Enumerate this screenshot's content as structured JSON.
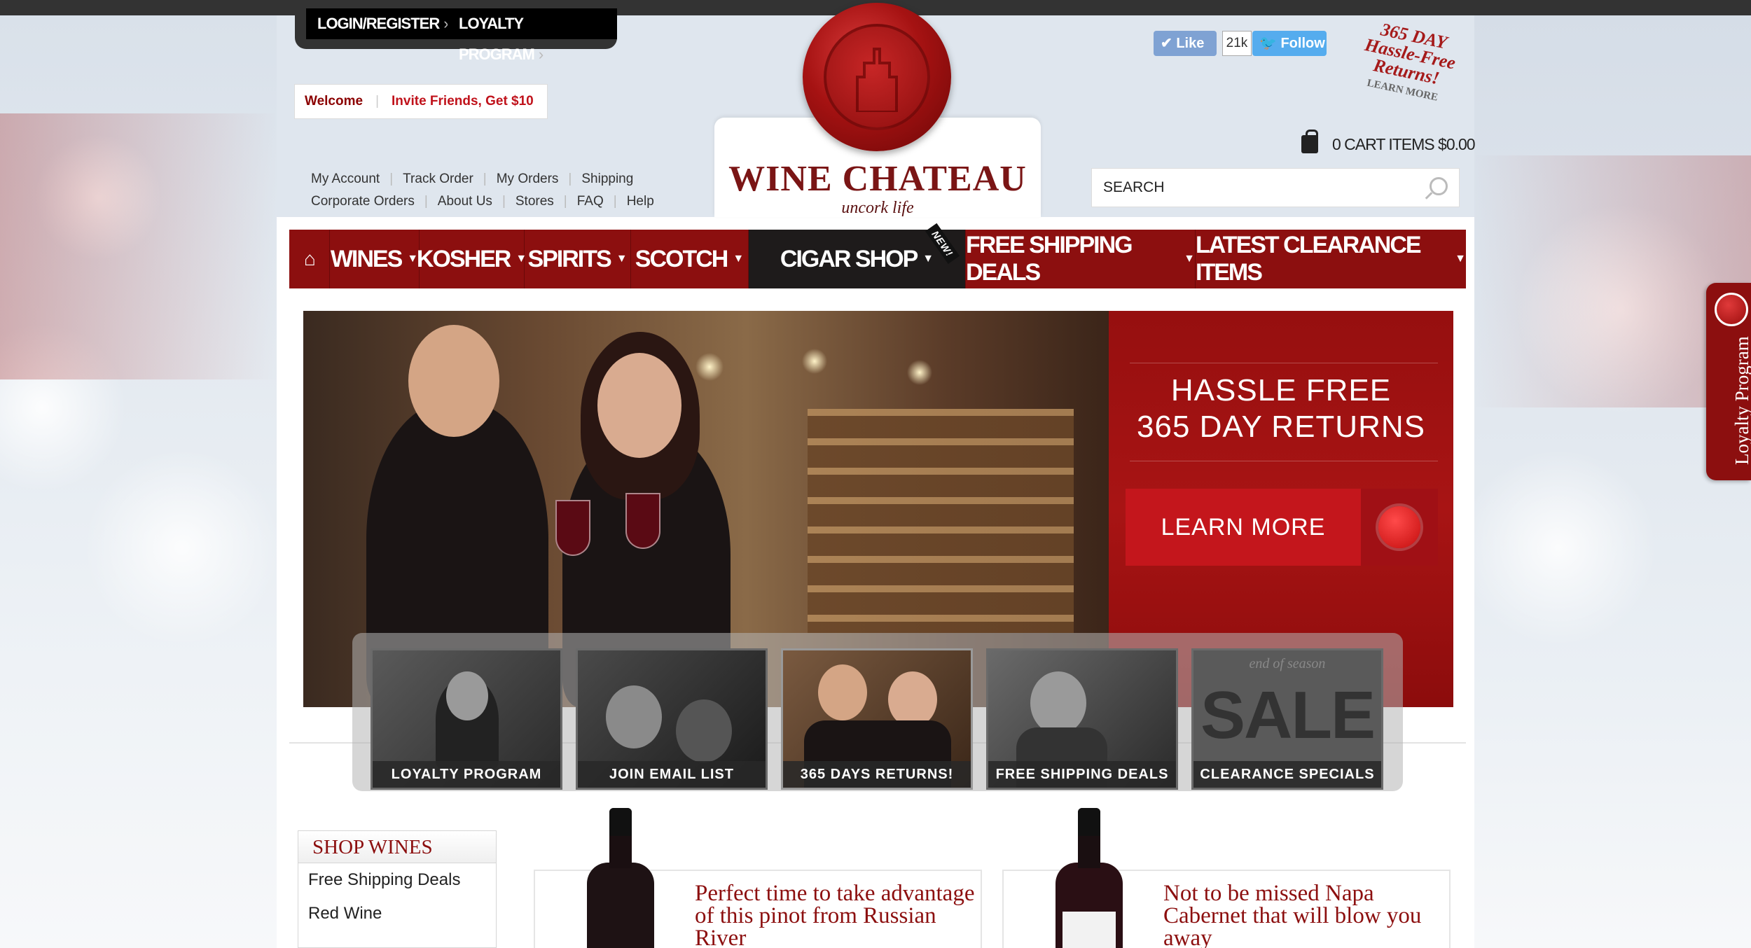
{
  "account": {
    "login_label": "LOGIN/REGISTER",
    "loyalty_label": "LOYALTY PROGRAM",
    "welcome": "Welcome",
    "invite": "Invite Friends, Get $10"
  },
  "links": {
    "row1": [
      "My Account",
      "Track Order",
      "My Orders",
      "Shipping"
    ],
    "row2": [
      "Corporate Orders",
      "About Us",
      "Stores",
      "FAQ",
      "Help"
    ]
  },
  "logo": {
    "title": "WINE CHATEAU",
    "tagline": "uncork life"
  },
  "social": {
    "like": "Like",
    "like_count": "21k",
    "follow": "Follow"
  },
  "returns_badge": {
    "line1": "365 DAY",
    "line2": "Hassle-Free",
    "line3": "Returns!",
    "cta": "LEARN MORE"
  },
  "cart": {
    "label": "0 CART ITEMS $0.00"
  },
  "search": {
    "placeholder": "SEARCH"
  },
  "nav": {
    "items": [
      "WINES",
      "KOSHER",
      "SPIRITS",
      "SCOTCH",
      "CIGAR SHOP",
      "FREE SHIPPING DEALS",
      "LATEST CLEARANCE ITEMS"
    ],
    "new_badge": "NEW!"
  },
  "hero": {
    "heading_line1": "HASSLE FREE",
    "heading_line2": "365 DAY RETURNS",
    "button": "LEARN MORE"
  },
  "thumbs": [
    "LOYALTY  PROGRAM",
    "JOIN EMAIL LIST",
    "365 DAYS RETURNS!",
    "FREE SHIPPING DEALS",
    "CLEARANCE SPECIALS"
  ],
  "sale_thumb": {
    "top": "end of season",
    "big": "SALE"
  },
  "shop": {
    "title": "SHOP WINES",
    "items": [
      "Free Shipping Deals",
      "Red Wine"
    ]
  },
  "promos": [
    {
      "text": "Perfect time to take advantage of this pinot from Russian River"
    },
    {
      "text": "Not to be missed Napa Cabernet that will blow you away"
    }
  ],
  "loyalty_tab": {
    "label": "Loyalty Program"
  },
  "colors": {
    "brand_red": "#8c0f0f",
    "accent_red": "#c4161c",
    "dark": "#333333"
  },
  "icons": {
    "home": "home-icon",
    "cart": "cart-icon",
    "search": "search-icon"
  }
}
